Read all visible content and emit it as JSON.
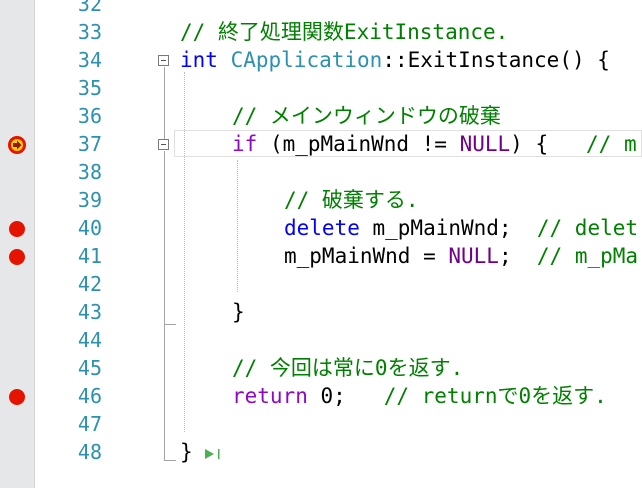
{
  "editor": {
    "lines": [
      {
        "num": "32",
        "code": [],
        "marker": ""
      },
      {
        "num": "33",
        "code": [
          {
            "t": "// 終了処理関数ExitInstance.",
            "c": "cm"
          }
        ],
        "marker": ""
      },
      {
        "num": "34",
        "code": [
          {
            "t": "int",
            "c": "kw"
          },
          {
            "t": " ",
            "c": ""
          },
          {
            "t": "CApplication",
            "c": "ty"
          },
          {
            "t": "::ExitInstance() {",
            "c": ""
          }
        ],
        "marker": ""
      },
      {
        "num": "35",
        "code": [],
        "marker": ""
      },
      {
        "num": "36",
        "code": [
          {
            "t": "// メインウィンドウの破棄",
            "c": "cm"
          }
        ],
        "marker": ""
      },
      {
        "num": "37",
        "code": [
          {
            "t": "if",
            "c": "kw2"
          },
          {
            "t": " (m_pMainWnd != ",
            "c": ""
          },
          {
            "t": "NULL",
            "c": "mc"
          },
          {
            "t": ") {   ",
            "c": ""
          },
          {
            "t": "// m",
            "c": "cm"
          }
        ],
        "marker": "current"
      },
      {
        "num": "38",
        "code": [],
        "marker": ""
      },
      {
        "num": "39",
        "code": [
          {
            "t": "// 破棄する.",
            "c": "cm"
          }
        ],
        "marker": ""
      },
      {
        "num": "40",
        "code": [
          {
            "t": "delete",
            "c": "kw"
          },
          {
            "t": " m_pMainWnd;  ",
            "c": ""
          },
          {
            "t": "// delet",
            "c": "cm"
          }
        ],
        "marker": "breakpoint"
      },
      {
        "num": "41",
        "code": [
          {
            "t": "m_pMainWnd = ",
            "c": ""
          },
          {
            "t": "NULL",
            "c": "mc"
          },
          {
            "t": ";  ",
            "c": ""
          },
          {
            "t": "// m_pMa",
            "c": "cm"
          }
        ],
        "marker": "breakpoint"
      },
      {
        "num": "42",
        "code": [],
        "marker": ""
      },
      {
        "num": "43",
        "code": [
          {
            "t": "}",
            "c": ""
          }
        ],
        "marker": ""
      },
      {
        "num": "44",
        "code": [],
        "marker": ""
      },
      {
        "num": "45",
        "code": [
          {
            "t": "// 今回は常に0を返す.",
            "c": "cm"
          }
        ],
        "marker": ""
      },
      {
        "num": "46",
        "code": [
          {
            "t": "return",
            "c": "kw2"
          },
          {
            "t": " 0;   ",
            "c": ""
          },
          {
            "t": "// returnで0を返す.",
            "c": "cm"
          }
        ],
        "marker": "breakpoint"
      },
      {
        "num": "47",
        "code": [],
        "marker": ""
      },
      {
        "num": "48",
        "code": [
          {
            "t": "}",
            "c": ""
          }
        ],
        "marker": ""
      }
    ]
  },
  "colors": {
    "keyword": "#0000ff",
    "control_keyword": "#8f08c4",
    "comment": "#008000",
    "type": "#2b91af",
    "macro": "#6f008a",
    "line_number": "#2b91af",
    "breakpoint": "#e51400",
    "current_statement": "#ffcc00"
  },
  "icons": {
    "breakpoint": "breakpoint-icon",
    "current_statement": "current-statement-icon",
    "fold_toggle": "collapse-icon",
    "run_to_click": "run-to-click-icon"
  }
}
